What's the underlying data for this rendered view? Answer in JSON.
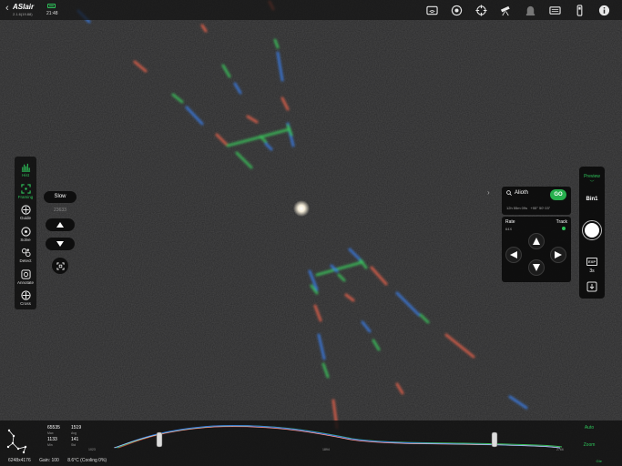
{
  "app": {
    "brand": "ASIair",
    "version": "2.1.6(19.88)",
    "clock": "21:48"
  },
  "top_icons": [
    "wifi-icon",
    "camera-icon",
    "mount-crosshair-icon",
    "telescope-icon",
    "guider-icon",
    "storage-icon",
    "filter-icon",
    "info-icon"
  ],
  "tools": [
    {
      "id": "hist",
      "label": "Hist",
      "icon": "histogram-icon",
      "active": true
    },
    {
      "id": "framing",
      "label": "Framing",
      "icon": "framing-icon",
      "active": true
    },
    {
      "id": "guide",
      "label": "Guide",
      "icon": "guide-icon",
      "active": false
    },
    {
      "id": "solve",
      "label": "Solve",
      "icon": "solve-icon",
      "active": false
    },
    {
      "id": "detect",
      "label": "Detect",
      "icon": "detect-icon",
      "active": false
    },
    {
      "id": "annotate",
      "label": "Annotate",
      "icon": "annotate-icon",
      "active": false
    },
    {
      "id": "cross",
      "label": "Cross",
      "icon": "cross-icon",
      "active": false
    }
  ],
  "focus_panel": {
    "speed": "Slow",
    "position": "23633"
  },
  "goto": {
    "target": "Alioth",
    "go_label": "GO",
    "ra": "12h 55m 09s",
    "dec": "+55° 50' 03\""
  },
  "mount": {
    "rate_label": "Rate",
    "rate_value": "64X",
    "track_label": "Track",
    "tracking_color": "#2ec35a"
  },
  "capture": {
    "mode": "Preview",
    "bin": "Bin1",
    "exp_label": "EXP",
    "exposure": "3s"
  },
  "stats": {
    "max": "65535",
    "max_label": "Max",
    "avg": "1519",
    "avg_label": "Avg",
    "min": "1133",
    "min_label": "Min",
    "std": "141",
    "std_label": "Std"
  },
  "histogram": {
    "ticks": [
      "1023",
      "1894",
      "2766"
    ],
    "auto_label": "Auto",
    "zoom_label": "Zoom"
  },
  "status": {
    "resolution": "6248x4176",
    "gain": "Gain: 100",
    "temp": "8.6°C (Cooling 0%)",
    "corner": "Gte"
  },
  "colors": {
    "accent": "#2ec35a",
    "go": "#27b04e"
  }
}
